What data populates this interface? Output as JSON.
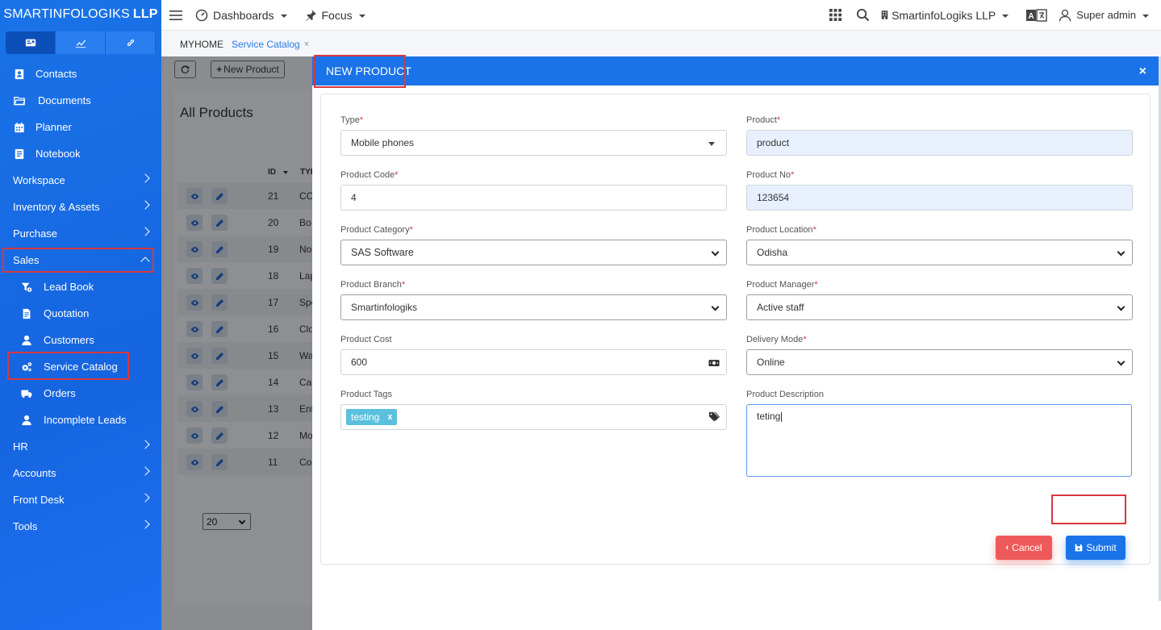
{
  "brand": {
    "light": "SMARTINFOLOGIKS",
    "bold": "LLP"
  },
  "topbar": {
    "dashboards": "Dashboards",
    "focus": "Focus",
    "company": "SmartinfoLogiks LLP",
    "user": "Super admin"
  },
  "sidebar": {
    "items": [
      {
        "label": "Contacts",
        "icon": "contact-icon"
      },
      {
        "label": "Documents",
        "icon": "folder-icon"
      },
      {
        "label": "Planner",
        "icon": "calendar-icon"
      },
      {
        "label": "Notebook",
        "icon": "notebook-icon"
      },
      {
        "label": "Workspace"
      },
      {
        "label": "Inventory & Assets"
      },
      {
        "label": "Purchase"
      },
      {
        "label": "Sales"
      }
    ],
    "sales_sub": [
      {
        "label": "Lead Book",
        "icon": "funnel-icon"
      },
      {
        "label": "Quotation",
        "icon": "document-icon"
      },
      {
        "label": "Customers",
        "icon": "user-icon"
      },
      {
        "label": "Service Catalog",
        "icon": "gears-icon"
      },
      {
        "label": "Orders",
        "icon": "truck-icon"
      },
      {
        "label": "Incomplete Leads",
        "icon": "user-icon"
      }
    ],
    "more": [
      {
        "label": "HR"
      },
      {
        "label": "Accounts"
      },
      {
        "label": "Front Desk"
      },
      {
        "label": "Tools"
      }
    ]
  },
  "breadcrumb": {
    "home": "MYHOME",
    "current": "Service Catalog",
    "close": "×"
  },
  "background": {
    "new_product_btn": "New Product",
    "title": "All Products",
    "col_id": "ID",
    "col_type": "TYP",
    "rows": [
      {
        "id": "21",
        "type": "CC"
      },
      {
        "id": "20",
        "type": "Bo"
      },
      {
        "id": "19",
        "type": "No"
      },
      {
        "id": "18",
        "type": "Lap"
      },
      {
        "id": "17",
        "type": "Spe"
      },
      {
        "id": "16",
        "type": "Clo"
      },
      {
        "id": "15",
        "type": "Wa"
      },
      {
        "id": "14",
        "type": "Car"
      },
      {
        "id": "13",
        "type": "Ent"
      },
      {
        "id": "12",
        "type": "Mo"
      },
      {
        "id": "11",
        "type": "Cor"
      }
    ],
    "page_size": "20"
  },
  "modal": {
    "title": "NEW PRODUCT",
    "close": "×",
    "fields": {
      "type": {
        "label": "Type",
        "value": "Mobile phones"
      },
      "product": {
        "label": "Product",
        "value": "product"
      },
      "code": {
        "label": "Product Code",
        "value": "4"
      },
      "number": {
        "label": "Product No",
        "value": "123654"
      },
      "category": {
        "label": "Product Category",
        "value": "SAS Software"
      },
      "location": {
        "label": "Product Location",
        "value": "Odisha"
      },
      "branch": {
        "label": "Product Branch",
        "value": "Smartinfologiks"
      },
      "manager": {
        "label": "Product Manager",
        "value": "Active staff"
      },
      "cost": {
        "label": "Product Cost",
        "value": "600"
      },
      "delivery": {
        "label": "Delivery Mode",
        "value": "Online"
      },
      "tags": {
        "label": "Product Tags",
        "tag": "testing",
        "remove": "x"
      },
      "description": {
        "label": "Product Description",
        "value": "teting"
      }
    },
    "required_mark": "*",
    "cancel": "Cancel",
    "submit": "Submit"
  },
  "colors": {
    "primary": "#1a73e8",
    "danger": "#ee5a5a",
    "tag": "#5bc0de",
    "highlight": "#d9373f"
  }
}
